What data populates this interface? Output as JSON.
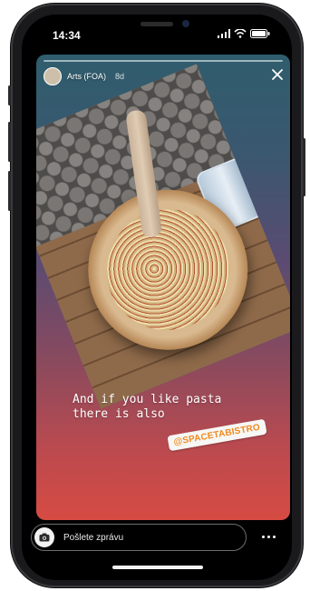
{
  "status_bar": {
    "time": "14:34",
    "icons": [
      "signal-icon",
      "wifi-icon",
      "battery-icon"
    ]
  },
  "story": {
    "user_name": "Arts (FOA)",
    "age": "8d",
    "caption": "And if you like pasta\nthere is also",
    "mention_sticker": "@SPACETABISTRO"
  },
  "reply": {
    "placeholder": "Pošlete zprávu"
  },
  "colors": {
    "mention_text": "#f08a1f",
    "gradient_top": "#2f5d6d",
    "gradient_bottom": "#d64b43"
  }
}
